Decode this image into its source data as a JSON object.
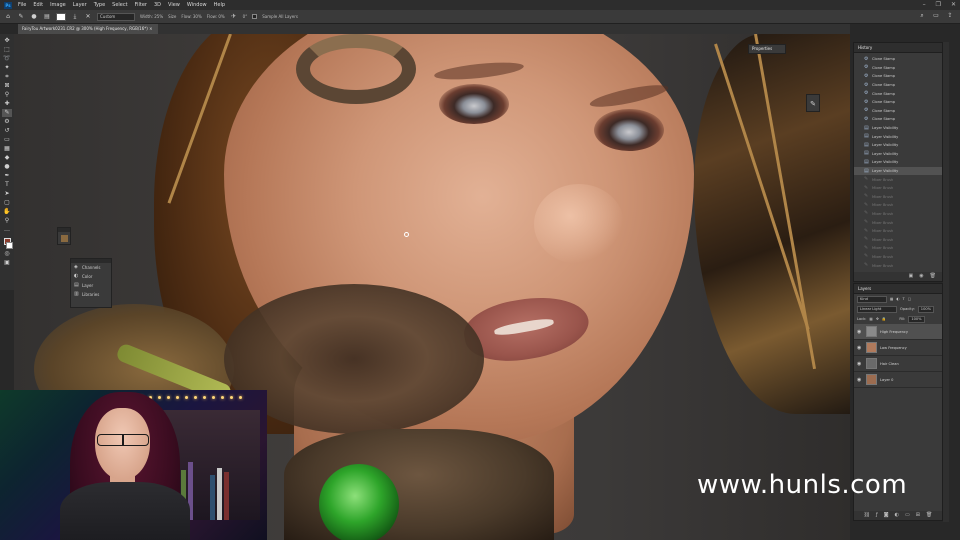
{
  "menubar": {
    "items": [
      "File",
      "Edit",
      "Image",
      "Layer",
      "Type",
      "Select",
      "Filter",
      "3D",
      "View",
      "Window",
      "Help"
    ],
    "logo": "Ps"
  },
  "options": {
    "tool_label": "Custom",
    "width_label": "Width: 25%",
    "size_label": "Size",
    "opacity_label": "Flow: 30%",
    "flow_label": "Flow: 0%",
    "angle_label": "0°",
    "sample_all_layers": "Sample All Layers"
  },
  "document": {
    "tab_title": "FairyTou Artwork0231.CR2 @ 300% (High Frequency, RGB/16*) ×"
  },
  "floating": {
    "properties_label": "Properties",
    "mini_panel_items": [
      "Channels",
      "Color",
      "Layer",
      "Libraries"
    ]
  },
  "history": {
    "tab_label": "History",
    "items": [
      {
        "label": "Clone Stamp",
        "state": "active",
        "icon": "stamp-icon"
      },
      {
        "label": "Clone Stamp",
        "state": "active",
        "icon": "stamp-icon"
      },
      {
        "label": "Clone Stamp",
        "state": "active",
        "icon": "stamp-icon"
      },
      {
        "label": "Clone Stamp",
        "state": "active",
        "icon": "stamp-icon"
      },
      {
        "label": "Clone Stamp",
        "state": "active",
        "icon": "stamp-icon"
      },
      {
        "label": "Clone Stamp",
        "state": "active",
        "icon": "stamp-icon"
      },
      {
        "label": "Clone Stamp",
        "state": "active",
        "icon": "stamp-icon"
      },
      {
        "label": "Clone Stamp",
        "state": "active",
        "icon": "stamp-icon"
      },
      {
        "label": "Layer Visibility",
        "state": "active",
        "icon": "layer-icon"
      },
      {
        "label": "Layer Visibility",
        "state": "active",
        "icon": "layer-icon"
      },
      {
        "label": "Layer Visibility",
        "state": "active",
        "icon": "layer-icon"
      },
      {
        "label": "Layer Visibility",
        "state": "active",
        "icon": "layer-icon"
      },
      {
        "label": "Layer Visibility",
        "state": "active",
        "icon": "layer-icon"
      },
      {
        "label": "Layer Visibility",
        "state": "selected",
        "icon": "layer-icon"
      },
      {
        "label": "Mixer Brush",
        "state": "inactive",
        "icon": "brush-icon"
      },
      {
        "label": "Mixer Brush",
        "state": "inactive",
        "icon": "brush-icon"
      },
      {
        "label": "Mixer Brush",
        "state": "inactive",
        "icon": "brush-icon"
      },
      {
        "label": "Mixer Brush",
        "state": "inactive",
        "icon": "brush-icon"
      },
      {
        "label": "Mixer Brush",
        "state": "inactive",
        "icon": "brush-icon"
      },
      {
        "label": "Mixer Brush",
        "state": "inactive",
        "icon": "brush-icon"
      },
      {
        "label": "Mixer Brush",
        "state": "inactive",
        "icon": "brush-icon"
      },
      {
        "label": "Mixer Brush",
        "state": "inactive",
        "icon": "brush-icon"
      },
      {
        "label": "Mixer Brush",
        "state": "inactive",
        "icon": "brush-icon"
      },
      {
        "label": "Mixer Brush",
        "state": "inactive",
        "icon": "brush-icon"
      },
      {
        "label": "Mixer Brush",
        "state": "inactive",
        "icon": "brush-icon"
      }
    ]
  },
  "layers": {
    "tab_label": "Layers",
    "kind_label": "Kind",
    "blend_mode": "Linear Light",
    "opacity_label": "Opacity:",
    "opacity_value": "100%",
    "lock_label": "Lock:",
    "fill_label": "Fill:",
    "fill_value": "100%",
    "items": [
      {
        "name": "High Frequency",
        "selected": true,
        "thumb": "#8a8a8a"
      },
      {
        "name": "Low Frequency",
        "selected": false,
        "thumb": "#b07a5c"
      },
      {
        "name": "Hair Clean",
        "selected": false,
        "thumb": "#6a6a6a"
      },
      {
        "name": "Layer 0",
        "selected": false,
        "thumb": "#9c6c50"
      }
    ]
  },
  "watermark": {
    "text": "www.hunls.com"
  }
}
